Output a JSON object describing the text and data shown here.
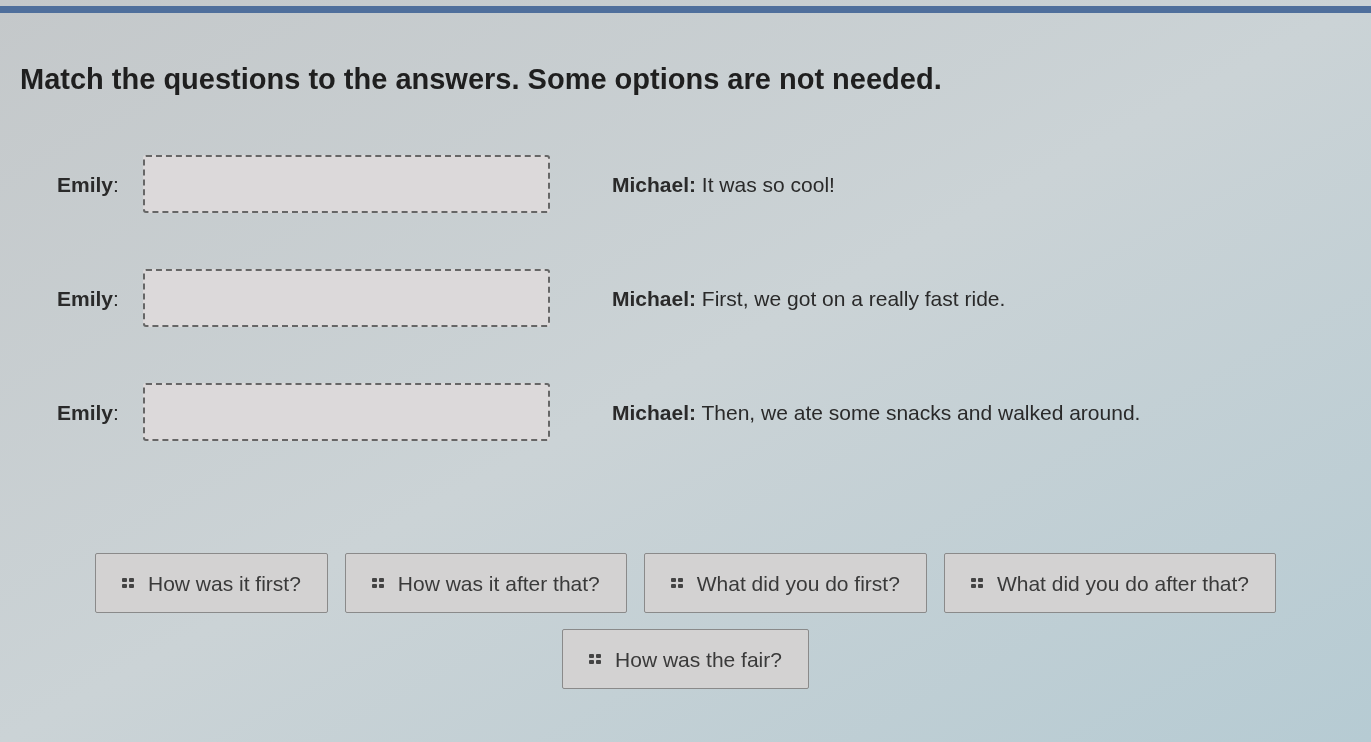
{
  "instruction": "Match the questions to the answers. Some options are not needed.",
  "dialogue": [
    {
      "speaker": "**Emily**:",
      "reply": "**Michael:** It was so cool!"
    },
    {
      "speaker": "**Emily**:",
      "reply": "**Michael:** First, we got on a really fast ride."
    },
    {
      "speaker": "**Emily**:",
      "reply": "**Michael:** Then, we ate some snacks and walked around."
    }
  ],
  "options": [
    {
      "label": "How was it first?"
    },
    {
      "label": "How was it after that?"
    },
    {
      "label": "What did you do first?"
    },
    {
      "label": "What did you do after that?"
    },
    {
      "label": "How was the fair?"
    }
  ]
}
